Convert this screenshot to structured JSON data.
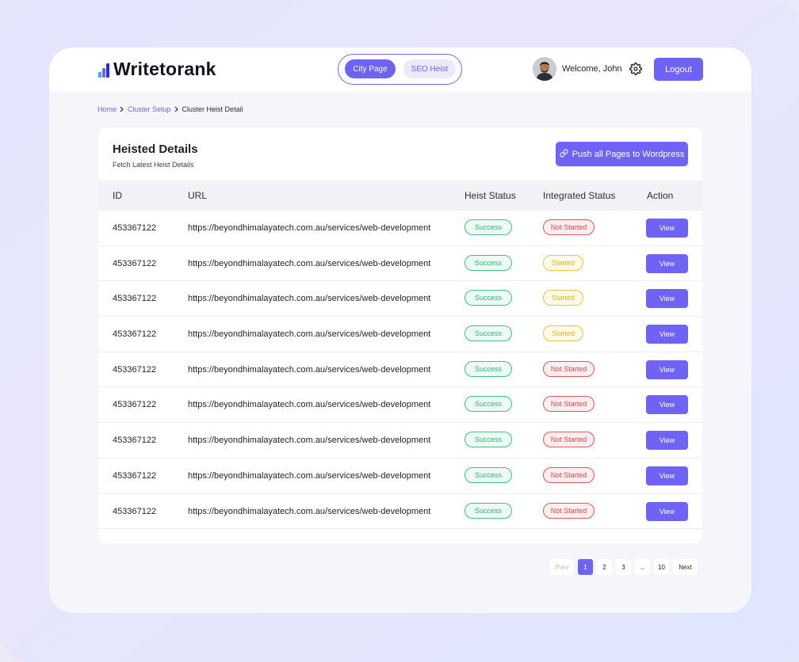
{
  "brand": {
    "name": "Writetorank"
  },
  "nav": {
    "tabs": [
      {
        "label": "City Page",
        "active": true
      },
      {
        "label": "SEO Heist",
        "active": false
      }
    ]
  },
  "user": {
    "welcome": "Welcome, John",
    "logout_label": "Logout"
  },
  "breadcrumb": {
    "items": [
      "Home",
      "Cluster Setup",
      "Cluster Heist Detail"
    ]
  },
  "panel": {
    "title": "Heisted Details",
    "subtitle": "Fetch Latest Heist Details",
    "push_button_label": "Push all Pages to Wordpress"
  },
  "table": {
    "headers": [
      "ID",
      "URL",
      "Heist Status",
      "Integrated Status",
      "Action"
    ],
    "rows": [
      {
        "id": "453367122",
        "url": "https://beyondhimalayatech.com.au/services/web-development",
        "heist_status": "Success",
        "integrated_status": "Not Started",
        "action": "View"
      },
      {
        "id": "453367122",
        "url": "https://beyondhimalayatech.com.au/services/web-development",
        "heist_status": "Success",
        "integrated_status": "Started",
        "action": "View"
      },
      {
        "id": "453367122",
        "url": "https://beyondhimalayatech.com.au/services/web-development",
        "heist_status": "Success",
        "integrated_status": "Started",
        "action": "View"
      },
      {
        "id": "453367122",
        "url": "https://beyondhimalayatech.com.au/services/web-development",
        "heist_status": "Success",
        "integrated_status": "Started",
        "action": "View"
      },
      {
        "id": "453367122",
        "url": "https://beyondhimalayatech.com.au/services/web-development",
        "heist_status": "Success",
        "integrated_status": "Not Started",
        "action": "View"
      },
      {
        "id": "453367122",
        "url": "https://beyondhimalayatech.com.au/services/web-development",
        "heist_status": "Success",
        "integrated_status": "Not Started",
        "action": "View"
      },
      {
        "id": "453367122",
        "url": "https://beyondhimalayatech.com.au/services/web-development",
        "heist_status": "Success",
        "integrated_status": "Not Started",
        "action": "View"
      },
      {
        "id": "453367122",
        "url": "https://beyondhimalayatech.com.au/services/web-development",
        "heist_status": "Success",
        "integrated_status": "Not Started",
        "action": "View"
      },
      {
        "id": "453367122",
        "url": "https://beyondhimalayatech.com.au/services/web-development",
        "heist_status": "Success",
        "integrated_status": "Not Started",
        "action": "View"
      }
    ]
  },
  "pagination": {
    "prev": "Prev",
    "pages": [
      "1",
      "2",
      "3",
      "...",
      "10"
    ],
    "current": "1",
    "next": "Next"
  },
  "colors": {
    "accent": "#6e63f4",
    "success": "#2bb57a",
    "not_started": "#e0434d",
    "started": "#e9b320"
  },
  "icons": {
    "logo": "bar-chart-icon",
    "settings": "gear-icon",
    "push": "link-icon",
    "breadcrumb_separator": "chevron-right-icon"
  }
}
